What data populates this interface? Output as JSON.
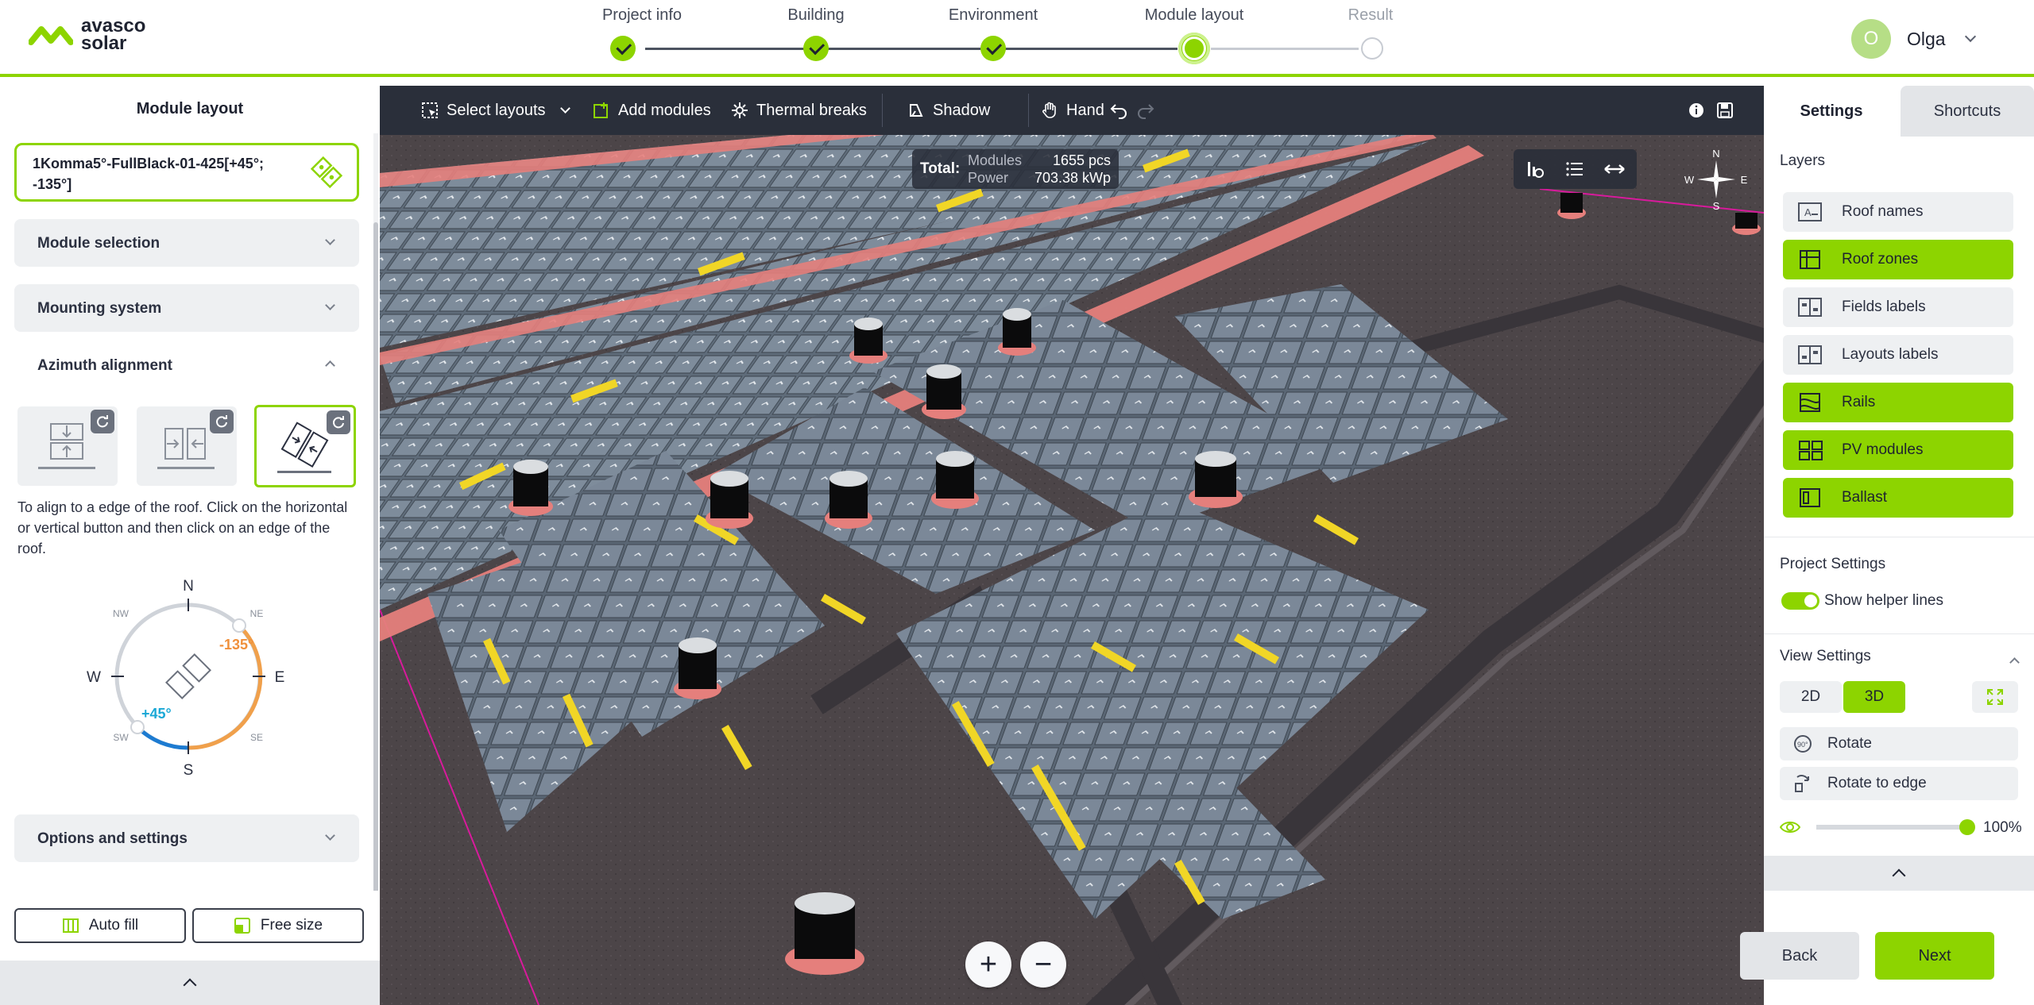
{
  "brand": {
    "line1": "avasco",
    "line2": "solar",
    "accent": "#8dd400"
  },
  "stepper": {
    "steps": [
      {
        "label": "Project info",
        "state": "done"
      },
      {
        "label": "Building",
        "state": "done"
      },
      {
        "label": "Environment",
        "state": "done"
      },
      {
        "label": "Module layout",
        "state": "current"
      },
      {
        "label": "Result",
        "state": "future"
      }
    ]
  },
  "user": {
    "initial": "O",
    "name": "Olga"
  },
  "left_panel": {
    "title": "Module layout",
    "layout_name": "1Komma5°-FullBlack-01-425[+45°; -135°]",
    "sections": {
      "module_selection": "Module selection",
      "mounting_system": "Mounting system",
      "azimuth_alignment": "Azimuth alignment",
      "options_settings": "Options and settings"
    },
    "align_text": "To align to a edge of the roof. Click on the horizontal or vertical button and then click on an edge of the roof.",
    "compass": {
      "n": "N",
      "s": "S",
      "e": "E",
      "w": "W",
      "ne": "NE",
      "nw": "NW",
      "se": "SE",
      "sw": "SW",
      "angle_a": "-135°",
      "angle_b": "+45°"
    },
    "auto_fill": "Auto fill",
    "free_size": "Free size"
  },
  "toolbar": {
    "select_layouts": "Select layouts",
    "add_modules": "Add modules",
    "thermal_breaks": "Thermal breaks",
    "shadow": "Shadow",
    "hand": "Hand"
  },
  "total": {
    "label": "Total:",
    "modules_label": "Modules",
    "modules_value": "1655 pcs",
    "power_label": "Power",
    "power_value": "703.38 kWp"
  },
  "compass_rose": {
    "n": "N",
    "e": "E",
    "s": "S",
    "w": "W"
  },
  "right_panel": {
    "tab_settings": "Settings",
    "tab_shortcuts": "Shortcuts",
    "layers_title": "Layers",
    "layers": [
      {
        "label": "Roof names",
        "on": false,
        "icon": "roof-names-icon"
      },
      {
        "label": "Roof zones",
        "on": true,
        "icon": "roof-zones-icon"
      },
      {
        "label": "Fields labels",
        "on": false,
        "icon": "fields-labels-icon"
      },
      {
        "label": "Layouts labels",
        "on": false,
        "icon": "layouts-labels-icon"
      },
      {
        "label": "Rails",
        "on": true,
        "icon": "rails-icon"
      },
      {
        "label": "PV modules",
        "on": true,
        "icon": "pv-modules-icon"
      },
      {
        "label": "Ballast",
        "on": true,
        "icon": "ballast-icon"
      }
    ],
    "project_settings": "Project Settings",
    "show_helper_lines": "Show helper lines",
    "view_settings": "View Settings",
    "view_2d": "2D",
    "view_3d": "3D",
    "rotate": "Rotate",
    "rotate_to_edge": "Rotate to edge",
    "opacity": "100%",
    "opacity_value": 1.0
  },
  "nav": {
    "back": "Back",
    "next": "Next"
  }
}
